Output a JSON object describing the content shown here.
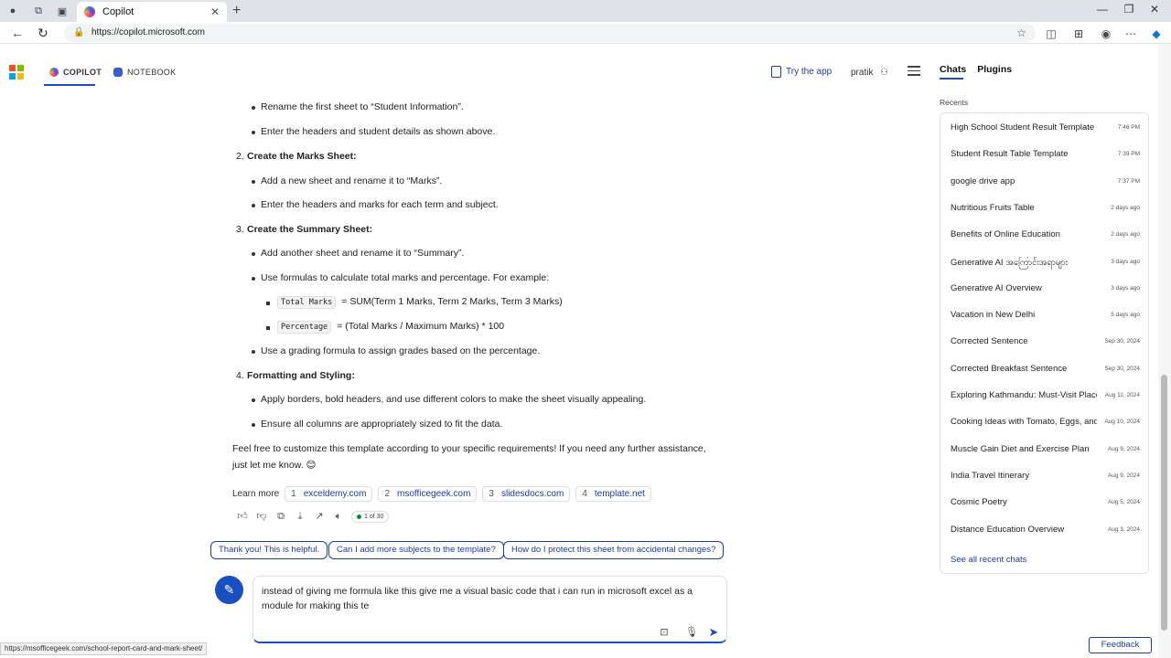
{
  "browser": {
    "tab_title": "Copilot",
    "url": "https://copilot.microsoft.com",
    "status_url": "https://msofficegeek.com/school-report-card-and-mark-sheet/"
  },
  "header": {
    "tab_copilot": "COPILOT",
    "tab_notebook": "NOTEBOOK",
    "try_app": "Try the app",
    "username": "pratik"
  },
  "content": {
    "l1": "Rename the first sheet to “Student Information”.",
    "l2": "Enter the headers and student details as shown above.",
    "h2_num": "2.",
    "h2": "Create the Marks Sheet:",
    "l3": "Add a new sheet and rename it to “Marks”.",
    "l4": "Enter the headers and marks for each term and subject.",
    "h3_num": "3.",
    "h3": "Create the Summary Sheet:",
    "l5": "Add another sheet and rename it to “Summary”.",
    "l6": "Use formulas to calculate total marks and percentage. For example:",
    "code1": "Total Marks",
    "f1": "= SUM(Term 1 Marks, Term 2 Marks, Term 3 Marks)",
    "code2": "Percentage",
    "f2": "= (Total Marks / Maximum Marks) * 100",
    "l7": "Use a grading formula to assign grades based on the percentage.",
    "h4_num": "4.",
    "h4": "Formatting and Styling:",
    "l8": "Apply borders, bold headers, and use different colors to make the sheet visually appealing.",
    "l9": "Ensure all columns are appropriately sized to fit the data.",
    "p1": "Feel free to customize this template according to your specific requirements! If you need any further assistance,",
    "p2": "just let me know. 😊",
    "learn_more": "Learn more",
    "sources": [
      {
        "n": "1",
        "label": "exceldemy.com"
      },
      {
        "n": "2",
        "label": "msofficegeek.com"
      },
      {
        "n": "3",
        "label": "slidesdocs.com"
      },
      {
        "n": "4",
        "label": "template.net"
      }
    ],
    "counter": "1 of 30"
  },
  "suggestions": [
    "Thank you! This is helpful.",
    "Can I add more subjects to the template?",
    "How do I protect this sheet from accidental changes?"
  ],
  "input": {
    "text": "instead of giving me formula like this give me a visual basic code that i can run in microsoft excel as a module for making this te"
  },
  "sidebar": {
    "tab_chats": "Chats",
    "tab_plugins": "Plugins",
    "recents_label": "Recents",
    "recents": [
      {
        "title": "High School Student Result Template",
        "date": "7:46 PM"
      },
      {
        "title": "Student Result Table Template",
        "date": "7:39 PM"
      },
      {
        "title": "google drive app",
        "date": "7:37 PM"
      },
      {
        "title": "Nutritious Fruits Table",
        "date": "2 days ago"
      },
      {
        "title": "Benefits of Online Education",
        "date": "2 days ago"
      },
      {
        "title": "Generative AI အကြောင်းအရာများ",
        "date": "3 days ago"
      },
      {
        "title": "Generative AI Overview",
        "date": "3 days ago"
      },
      {
        "title": "Vacation in New Delhi",
        "date": "5 days ago"
      },
      {
        "title": "Corrected Sentence",
        "date": "Sep 30, 2024"
      },
      {
        "title": "Corrected Breakfast Sentence",
        "date": "Sep 30, 2024"
      },
      {
        "title": "Exploring Kathmandu: Must-Visit Places",
        "date": "Aug 11, 2024"
      },
      {
        "title": "Cooking Ideas with Tomato, Eggs, and",
        "date": "Aug 10, 2024"
      },
      {
        "title": "Muscle Gain Diet and Exercise Plan",
        "date": "Aug 9, 2024"
      },
      {
        "title": "India Travel Itinerary",
        "date": "Aug 9, 2024"
      },
      {
        "title": "Cosmic Poetry",
        "date": "Aug 5, 2024"
      },
      {
        "title": "Distance Education Overview",
        "date": "Aug 3, 2024"
      }
    ],
    "see_all": "See all recent chats"
  },
  "feedback": "Feedback",
  "colors": {
    "accent": "#1a4fbf",
    "link": "#1a3d9e"
  }
}
